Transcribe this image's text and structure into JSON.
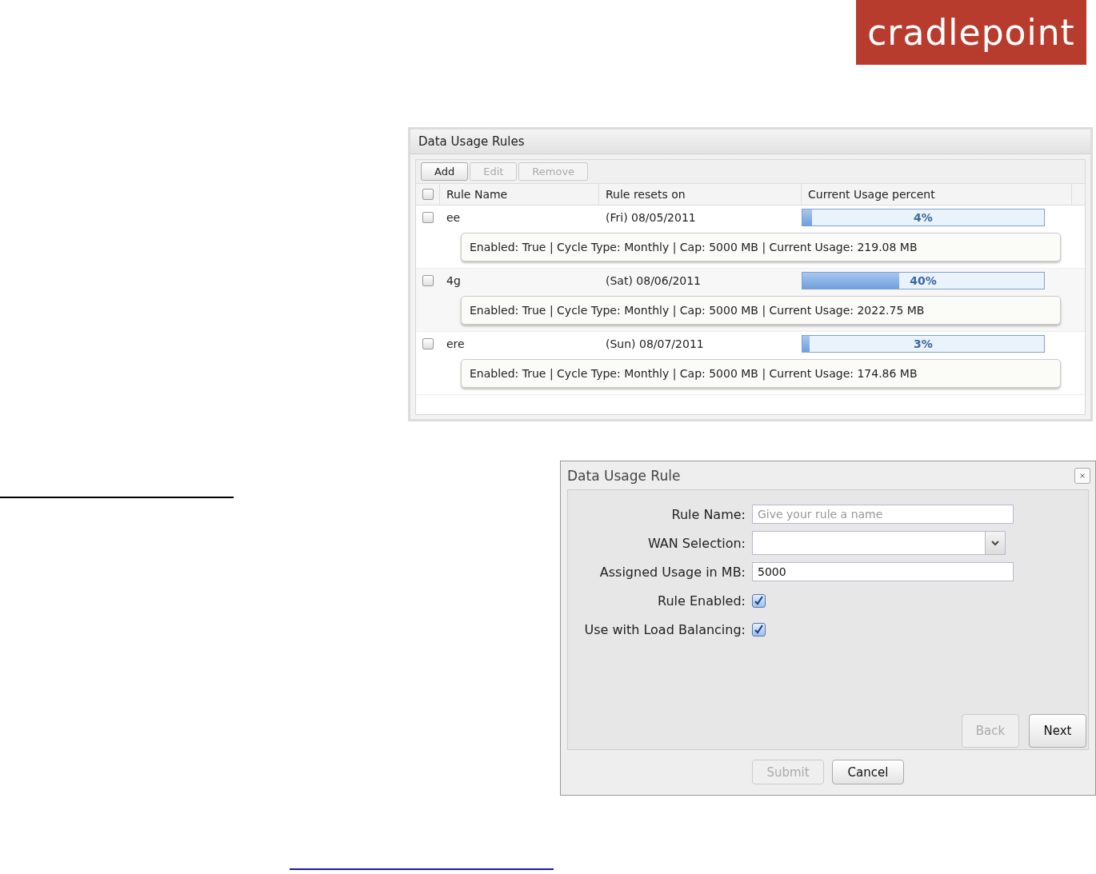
{
  "logo": {
    "text": "cradlepoint"
  },
  "rules_panel": {
    "title": "Data Usage Rules",
    "toolbar": [
      {
        "label": "Add",
        "disabled": false
      },
      {
        "label": "Edit",
        "disabled": true
      },
      {
        "label": "Remove",
        "disabled": true
      }
    ],
    "header_checked": false,
    "columns": [
      "Rule Name",
      "Rule resets on",
      "Current Usage percent"
    ],
    "rows": [
      {
        "checked": false,
        "name": "ee",
        "resets": "(Fri) 08/05/2011",
        "level": 0.04,
        "percent": "4%",
        "details": "Enabled: True | Cycle Type: Monthly | Cap: 5000 MB | Current Usage: 219.08 MB"
      },
      {
        "checked": false,
        "name": "4g",
        "resets": "(Sat) 08/06/2011",
        "level": 0.4,
        "percent": "40%",
        "details": "Enabled: True | Cycle Type: Monthly | Cap: 5000 MB | Current Usage: 2022.75 MB"
      },
      {
        "checked": false,
        "name": "ere",
        "resets": "(Sun) 08/07/2011",
        "level": 0.03,
        "percent": "3%",
        "details": "Enabled: True | Cycle Type: Monthly | Cap: 5000 MB | Current Usage: 174.86 MB"
      }
    ]
  },
  "dialog": {
    "title": "Data Usage Rule",
    "fields": [
      {
        "kind": "text",
        "label": "Rule Name:",
        "placeholder": "Give your rule a name"
      },
      {
        "kind": "select",
        "label": "WAN Selection:"
      },
      {
        "kind": "text",
        "label": "Assigned Usage in MB:",
        "value": "5000"
      },
      {
        "kind": "checkbox",
        "label": "Rule Enabled:",
        "checked": true
      },
      {
        "kind": "checkbox",
        "label": "Use with Load Balancing:",
        "checked": true
      }
    ],
    "nav_buttons": [
      {
        "label": "Back",
        "disabled": true
      },
      {
        "label": "Next",
        "disabled": false
      }
    ],
    "footer_buttons": [
      {
        "label": "Submit",
        "disabled": true
      },
      {
        "label": "Cancel",
        "disabled": false
      }
    ]
  }
}
